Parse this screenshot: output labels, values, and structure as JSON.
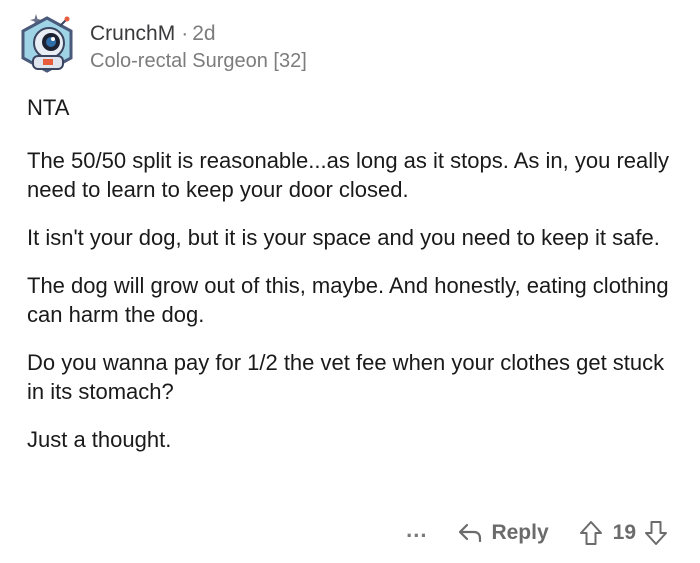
{
  "comment": {
    "author": "CrunchM",
    "separator": "·",
    "age": "2d",
    "flair": "Colo-rectal Surgeon [32]",
    "paragraphs": [
      "NTA",
      "The 50/50 split is reasonable...as long as it stops. As in, you really need to learn to keep your door closed.",
      "It isn't your dog, but it is your space and you need to keep it safe.",
      "The dog will grow out of this, maybe. And honestly, eating clothing can harm the dog.",
      "Do you wanna pay for 1/2 the vet fee when your clothes get stuck in its stomach?",
      "Just a thought."
    ]
  },
  "actions": {
    "more_label": "...",
    "reply_label": "Reply",
    "score": "19",
    "icons": {
      "reply": "reply-arrow-icon",
      "upvote": "upvote-arrow-icon",
      "downvote": "downvote-arrow-icon"
    }
  },
  "colors": {
    "text": "#1a1a1b",
    "meta": "#7c7c7c",
    "action": "#6b6b6b"
  }
}
